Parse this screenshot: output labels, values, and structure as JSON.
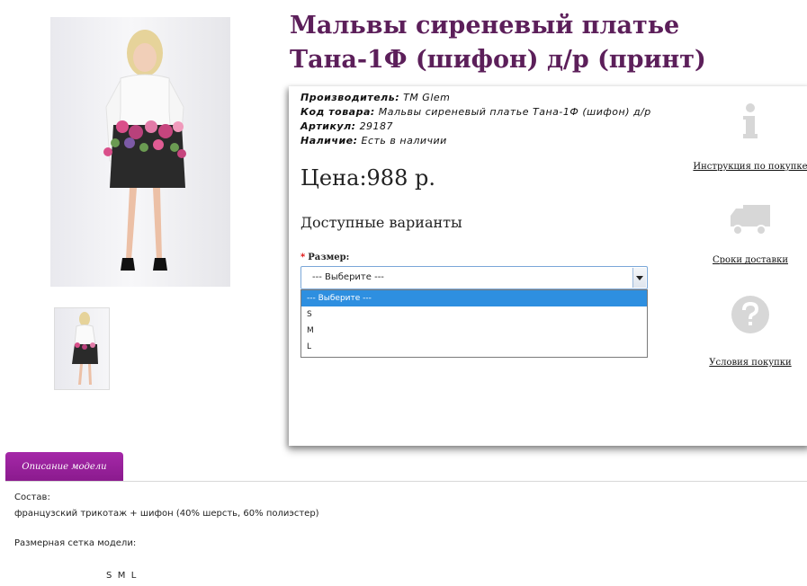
{
  "product": {
    "title": "Мальвы сиреневый платье Тана-1Ф (шифон) д/р (принт)",
    "image_alt": "dress photo"
  },
  "info": {
    "manufacturer_label": "Производитель:",
    "manufacturer_value": "TM Glem",
    "code_label": "Код товара:",
    "code_value": "Мальвы сиреневый платье Тана-1Ф (шифон) д/р",
    "sku_label": "Артикул:",
    "sku_value": "29187",
    "stock_label": "Наличие:",
    "stock_value": "Есть в наличии",
    "price": "Цена:988 р."
  },
  "options": {
    "heading": "Доступные варианты",
    "required_mark": "*",
    "size_label": "Размер:",
    "selected": "--- Выберите ---",
    "list": [
      "--- Выберите ---",
      "S",
      "M",
      "L"
    ]
  },
  "side": {
    "instruction_link": "Инструкция по покупке",
    "delivery_link": "Сроки доставки",
    "terms_link": "Условия покупки"
  },
  "tabs": {
    "description_tab": "Описание модели"
  },
  "description": {
    "composition_label": "Состав:",
    "composition_value": "французский трикотаж + шифон (40% шерсть, 60% полиэстер)",
    "size_grid_label": "Размерная сетка модели:",
    "size_grid_values": "S  M  L"
  },
  "colors": {
    "title": "#5c1f5a",
    "tab": "#9b229e",
    "selected_option": "#2e8fe0",
    "icon_gray": "#d7d7d7"
  }
}
